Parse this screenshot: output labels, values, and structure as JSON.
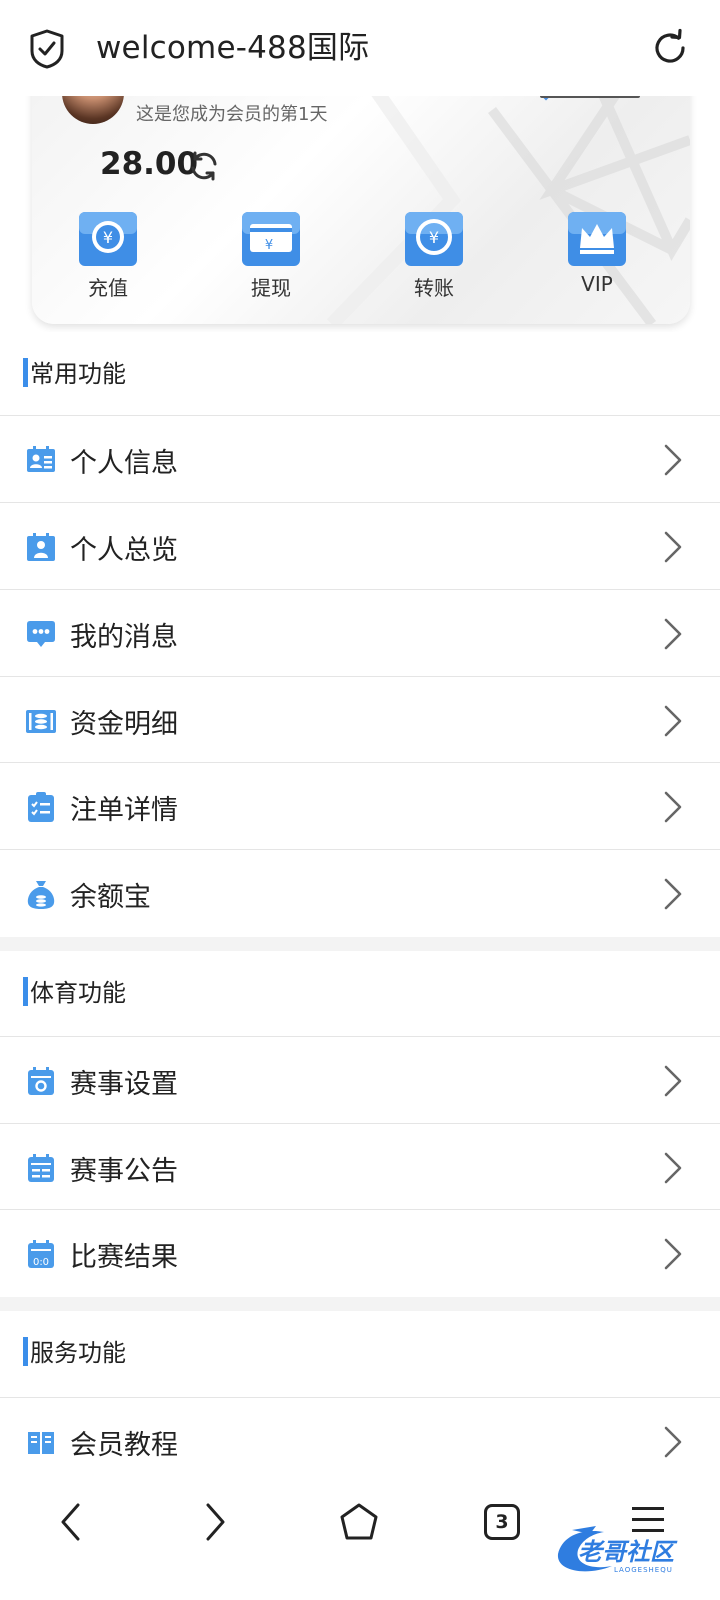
{
  "browser": {
    "title": "welcome-488国际",
    "tab_count": "3"
  },
  "card": {
    "days_text": "这是您成为会员的第1天",
    "balance": "28.00",
    "actions": [
      {
        "label": "充值",
        "icon": "deposit-icon"
      },
      {
        "label": "提现",
        "icon": "withdraw-icon"
      },
      {
        "label": "转账",
        "icon": "transfer-icon"
      },
      {
        "label": "VIP",
        "icon": "vip-crown-icon"
      }
    ]
  },
  "sections": [
    {
      "title": "常用功能",
      "items": [
        {
          "label": "个人信息",
          "icon": "id-card-icon"
        },
        {
          "label": "个人总览",
          "icon": "profile-overview-icon"
        },
        {
          "label": "我的消息",
          "icon": "message-icon"
        },
        {
          "label": "资金明细",
          "icon": "funds-icon"
        },
        {
          "label": "注单详情",
          "icon": "bet-list-icon"
        },
        {
          "label": "余额宝",
          "icon": "money-bag-icon"
        }
      ]
    },
    {
      "title": "体育功能",
      "items": [
        {
          "label": "赛事设置",
          "icon": "calendar-settings-icon"
        },
        {
          "label": "赛事公告",
          "icon": "calendar-notice-icon"
        },
        {
          "label": "比赛结果",
          "icon": "calendar-score-icon"
        }
      ]
    },
    {
      "title": "服务功能",
      "items": [
        {
          "label": "会员教程",
          "icon": "book-icon"
        }
      ]
    }
  ],
  "colors": {
    "accent": "#3b8eea",
    "icon_blue": "#4a9bea"
  },
  "watermark": "老哥社区"
}
